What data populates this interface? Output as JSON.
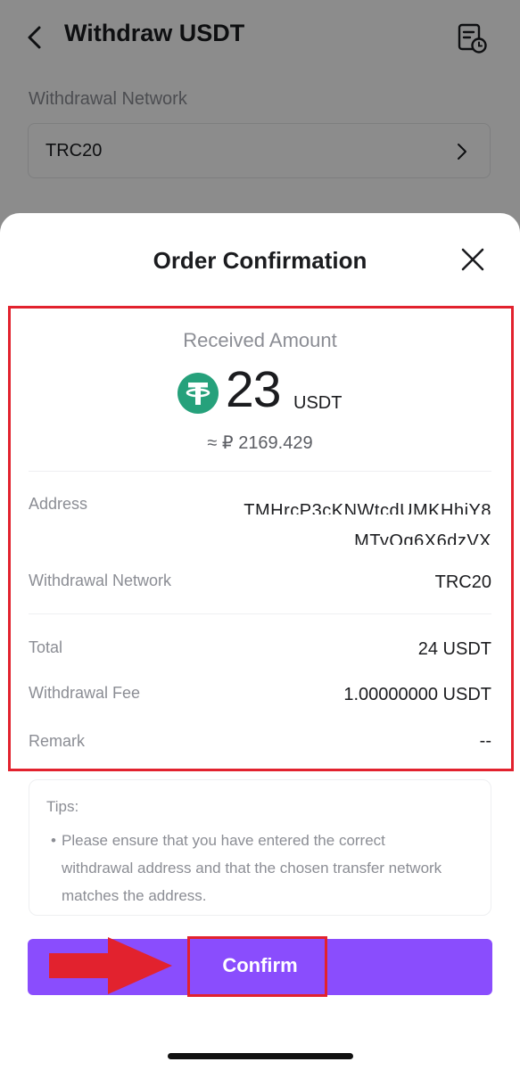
{
  "header": {
    "title": "Withdraw USDT",
    "back_icon": "chevron-left-icon",
    "record_icon": "history-record-icon"
  },
  "network_section": {
    "label": "Withdrawal Network",
    "value": "TRC20",
    "chevron_icon": "chevron-right-icon"
  },
  "sheet": {
    "title": "Order Confirmation",
    "close_icon": "close-icon",
    "received_label": "Received Amount",
    "amount": "23",
    "unit": "USDT",
    "coin_icon": "tether-icon",
    "approx_value": "≈ ₽ 2169.429",
    "details": {
      "address_label": "Address",
      "address_line1": "TMHrcP3cKNWtcdUMKHhiY8",
      "address_line2": "MTyQg6X6dzVX",
      "network_label": "Withdrawal Network",
      "network_value": "TRC20",
      "total_label": "Total",
      "total_value": "24 USDT",
      "fee_label": "Withdrawal Fee",
      "fee_value": "1.00000000 USDT",
      "remark_label": "Remark",
      "remark_value": "--"
    },
    "tips": {
      "title": "Tips:",
      "bullet": "•",
      "text": "Please ensure that you have entered the correct withdrawal address and that the chosen transfer network matches the address."
    },
    "confirm_label": "Confirm"
  },
  "colors": {
    "accent": "#8a4dfd",
    "highlight": "#e2222e",
    "tether": "#26a17b",
    "muted_text": "#8b8d94"
  }
}
